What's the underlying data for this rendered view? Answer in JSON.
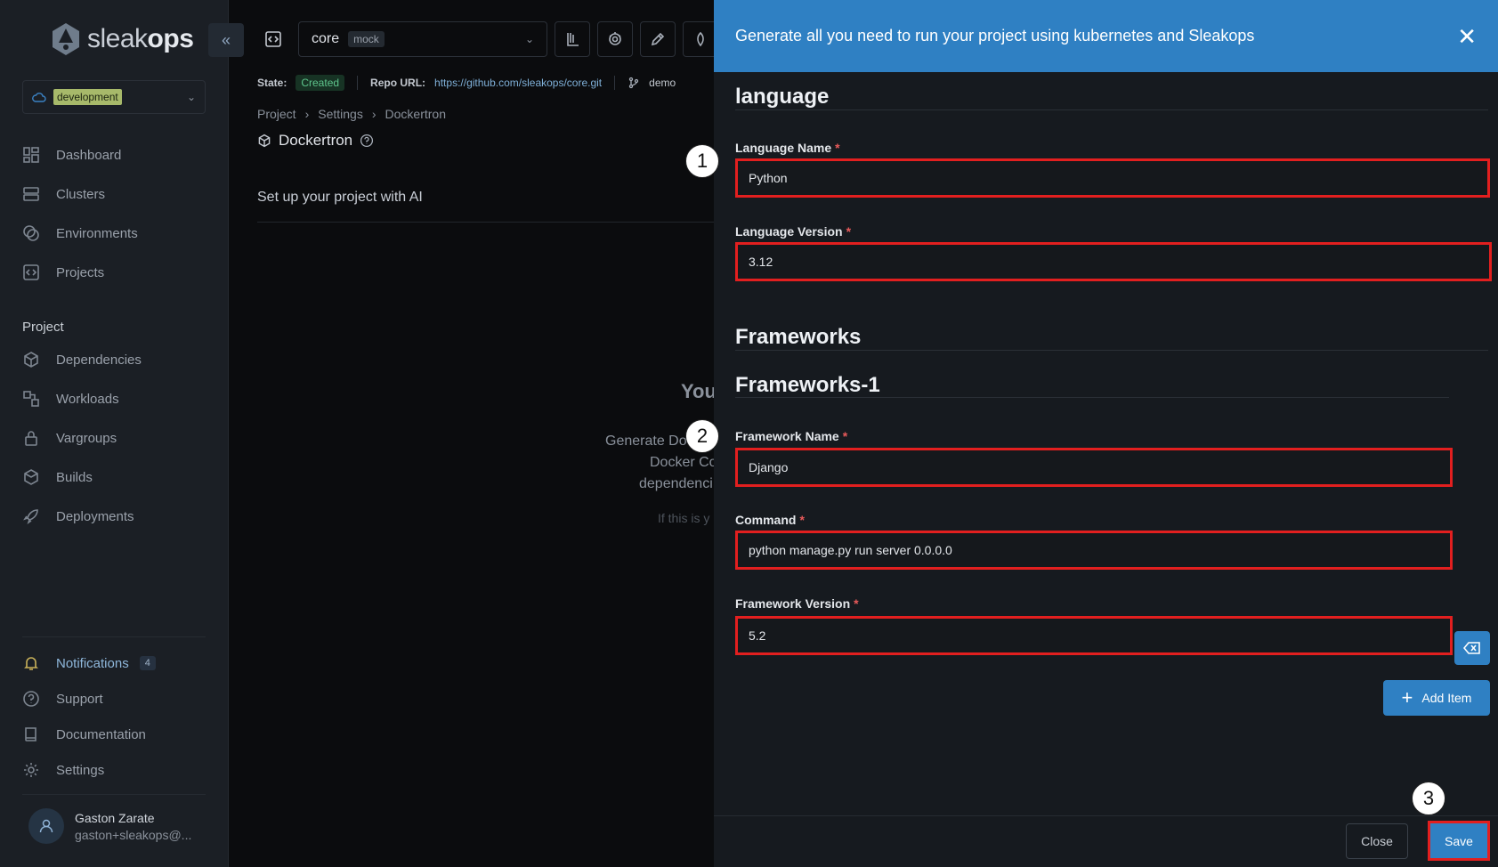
{
  "app": {
    "logo_prefix": "sleak",
    "logo_suffix": "ops"
  },
  "sidebar": {
    "environment": "development",
    "nav": [
      {
        "label": "Dashboard",
        "icon": "dashboard-icon"
      },
      {
        "label": "Clusters",
        "icon": "server-icon"
      },
      {
        "label": "Environments",
        "icon": "environments-icon"
      },
      {
        "label": "Projects",
        "icon": "code-icon"
      }
    ],
    "project_section": "Project",
    "project_nav": [
      {
        "label": "Dependencies",
        "icon": "cube-icon"
      },
      {
        "label": "Workloads",
        "icon": "workloads-icon"
      },
      {
        "label": "Vargroups",
        "icon": "lock-icon"
      },
      {
        "label": "Builds",
        "icon": "boxes-icon"
      },
      {
        "label": "Deployments",
        "icon": "rocket-icon"
      }
    ],
    "bottom_nav": {
      "notifications": "Notifications",
      "notifications_count": "4",
      "support": "Support",
      "documentation": "Documentation",
      "settings": "Settings"
    },
    "user": {
      "name": "Gaston Zarate",
      "email": "gaston+sleakops@..."
    }
  },
  "main": {
    "project": "core",
    "project_tag": "mock",
    "state_label": "State:",
    "state_value": "Created",
    "repo_label": "Repo URL:",
    "repo_url": "https://github.com/sleakops/core.git",
    "branch": "demo",
    "breadcrumb": [
      "Project",
      "Settings",
      "Dockertron"
    ],
    "page_title": "Dockertron",
    "setup_title": "Set up your project with AI",
    "ghost_title": "You",
    "ghost_lines": [
      "Generate Do",
      "Docker Co",
      "dependenci"
    ],
    "ghost_note": "If this is y"
  },
  "modal": {
    "title": "Generate all you need to run your project using kubernetes and Sleakops",
    "language_section": "language",
    "language_name_label": "Language Name",
    "language_name_value": "Python",
    "language_version_label": "Language Version",
    "language_version_value": "3.12",
    "frameworks_section": "Frameworks",
    "frameworks_item": "Frameworks-1",
    "framework_name_label": "Framework Name",
    "framework_name_value": "Django",
    "command_label": "Command",
    "command_value": "python manage.py run server 0.0.0.0",
    "framework_version_label": "Framework Version",
    "framework_version_value": "5.2",
    "required_mark": "*",
    "add_item": "Add Item",
    "close": "Close",
    "save": "Save"
  },
  "steps": [
    "1",
    "2",
    "3"
  ],
  "colors": {
    "accent": "#2f80c3",
    "highlight": "#e21f1f",
    "state_green": "#5ec58c"
  }
}
